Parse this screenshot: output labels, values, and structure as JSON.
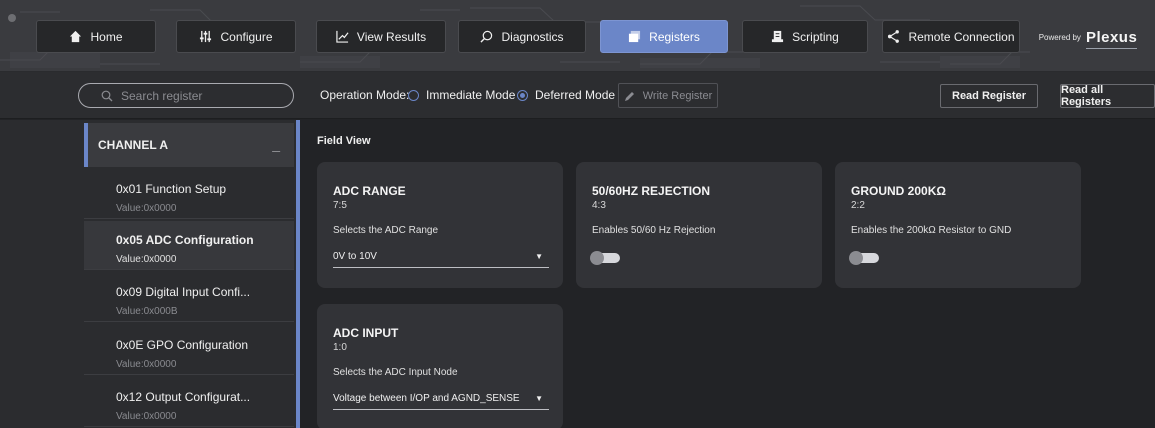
{
  "nav": {
    "items": [
      {
        "label": "Home",
        "icon": "home-icon"
      },
      {
        "label": "Configure",
        "icon": "sliders-icon"
      },
      {
        "label": "View Results",
        "icon": "chart-line-icon"
      },
      {
        "label": "Diagnostics",
        "icon": "magnifier-icon"
      },
      {
        "label": "Registers",
        "icon": "registers-icon",
        "active": true
      },
      {
        "label": "Scripting",
        "icon": "script-icon"
      },
      {
        "label": "Remote Connection",
        "icon": "share-icon"
      }
    ],
    "powered_by": "Powered by",
    "brand": "Plexus"
  },
  "toolbar": {
    "search_placeholder": "Search register",
    "operation_mode_label": "Operation Mode:",
    "modes": [
      {
        "label": "Immediate Mode",
        "selected": false
      },
      {
        "label": "Deferred Mode",
        "selected": true
      }
    ],
    "write_register_label": "Write Register",
    "read_register_label": "Read Register",
    "read_all_label": "Read all Registers"
  },
  "sidebar": {
    "channel_label": "CHANNEL A",
    "collapse_symbol": "_",
    "registers": [
      {
        "name": "0x01  Function Setup",
        "value": "Value:0x0000",
        "active": false
      },
      {
        "name": "0x05  ADC Configuration",
        "value": "Value:0x0000",
        "active": true
      },
      {
        "name": "0x09  Digital Input Confi...",
        "value": "Value:0x000B",
        "active": false
      },
      {
        "name": "0x0E  GPO Configuration",
        "value": "Value:0x0000",
        "active": false
      },
      {
        "name": "0x12  Output Configurat...",
        "value": "Value:0x0000",
        "active": false
      }
    ]
  },
  "main": {
    "title": "Field View",
    "fields": [
      {
        "title": "ADC RANGE",
        "bits": "7:5",
        "desc": "Selects the ADC Range",
        "control": "select",
        "value": "0V to 10V"
      },
      {
        "title": "50/60HZ REJECTION",
        "bits": "4:3",
        "desc": "Enables 50/60 Hz Rejection",
        "control": "toggle",
        "on": false
      },
      {
        "title": "GROUND 200KΩ",
        "bits": "2:2",
        "desc": "Enables the 200kΩ Resistor to GND",
        "control": "toggle",
        "on": false
      },
      {
        "title": "ADC INPUT",
        "bits": "1:0",
        "desc": "Selects the ADC Input Node",
        "control": "select",
        "value": "Voltage between I/OP and AGND_SENSE"
      }
    ]
  },
  "colors": {
    "accent": "#6b86c8",
    "background": "#222326",
    "card": "#323337"
  }
}
